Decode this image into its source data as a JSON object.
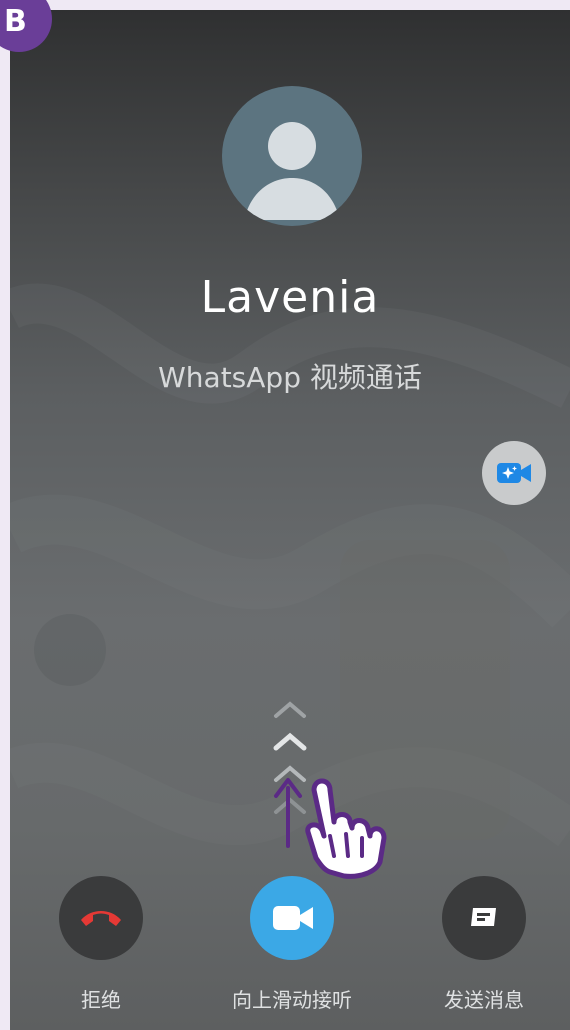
{
  "badge": {
    "letter": "B"
  },
  "call": {
    "caller_name": "Lavenia",
    "call_type": "WhatsApp 视频通话"
  },
  "actions": {
    "decline_label": "拒绝",
    "accept_label": "向上滑动接听",
    "message_label": "发送消息"
  },
  "icons": {
    "avatar": "person-silhouette-icon",
    "effects": "video-effects-sparkle-icon",
    "decline": "phone-hangup-icon",
    "accept": "videocam-icon",
    "message": "message-icon",
    "swipe_hint": "chevron-up-icon",
    "gesture": "hand-swipe-up-icon"
  },
  "colors": {
    "badge": "#6a3e98",
    "accept": "#3ba8e6",
    "decline_icon": "#e53935",
    "effects_icon": "#1e88e5",
    "gesture": "#5b2a86"
  }
}
